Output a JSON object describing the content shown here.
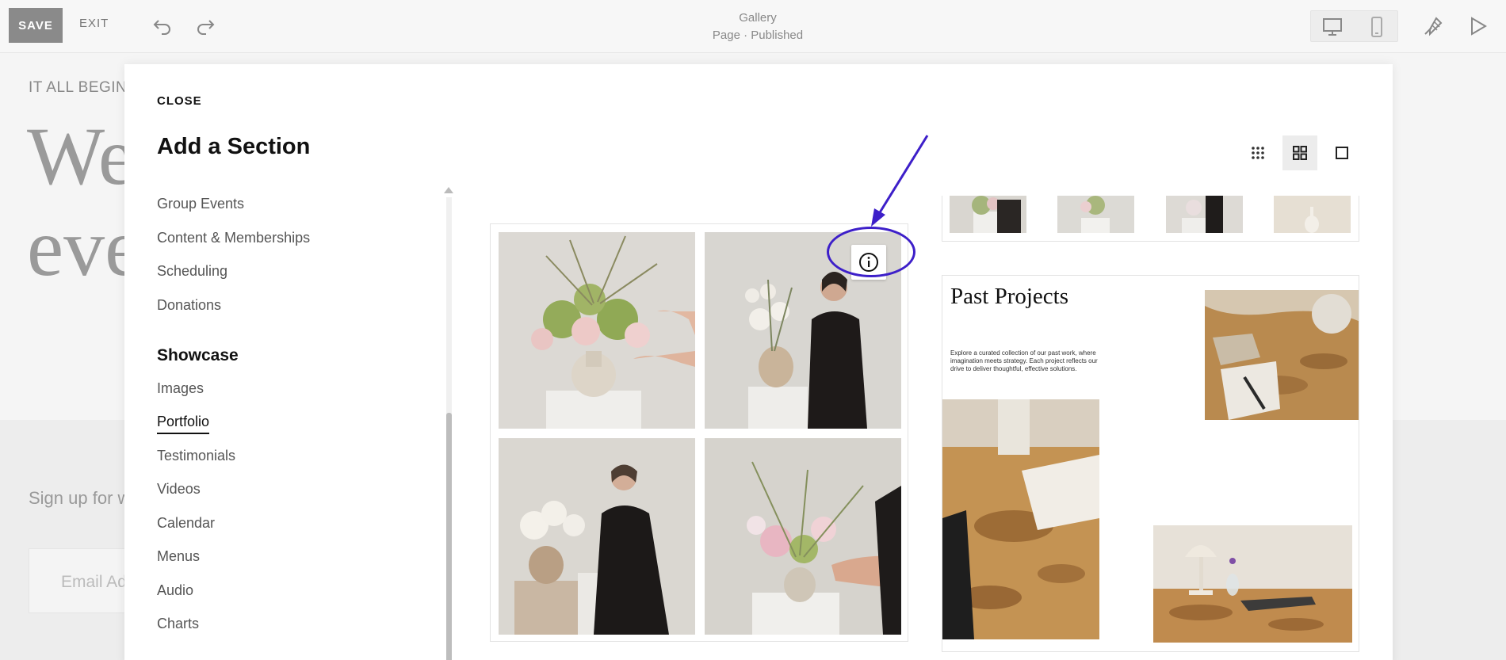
{
  "topbar": {
    "save_label": "SAVE",
    "exit_label": "EXIT",
    "page_title": "Gallery",
    "page_status": "Page · Published",
    "icons": [
      "undo-icon",
      "redo-icon",
      "desktop-icon",
      "mobile-icon",
      "design-brush-icon",
      "preview-play-icon"
    ]
  },
  "background_page": {
    "eyebrow": "IT ALL BEGINS",
    "headline_line1": "We",
    "headline_line2": "ever",
    "signup": "Sign up for w",
    "email_placeholder": "Email Ad"
  },
  "modal": {
    "close_label": "CLOSE",
    "title": "Add a Section",
    "categories": [
      {
        "label": "Group Events"
      },
      {
        "label": "Content & Memberships"
      },
      {
        "label": "Scheduling"
      },
      {
        "label": "Donations"
      }
    ],
    "showcase_heading": "Showcase",
    "showcase_items": [
      {
        "label": "Images"
      },
      {
        "label": "Portfolio",
        "active": true
      },
      {
        "label": "Testimonials"
      },
      {
        "label": "Videos"
      },
      {
        "label": "Calendar"
      },
      {
        "label": "Menus"
      },
      {
        "label": "Audio"
      },
      {
        "label": "Charts"
      }
    ],
    "view_options": [
      "grid-small-icon",
      "grid-large-icon",
      "single-view-icon"
    ],
    "active_view": "grid-large-icon",
    "past_projects": {
      "title": "Past Projects",
      "body": "Explore a curated collection of our past work, where imagination meets strategy. Each project reflects our drive to deliver thoughtful, effective solutions."
    },
    "annotation_color": "#3d1fc9"
  }
}
